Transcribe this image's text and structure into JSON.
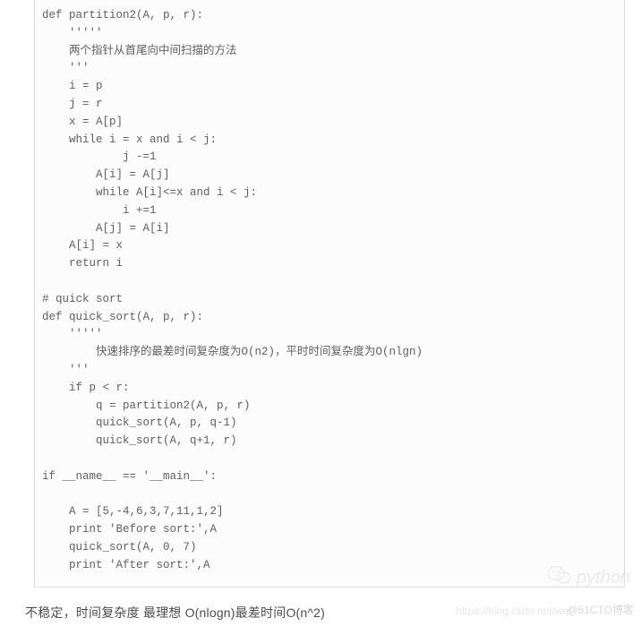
{
  "code": {
    "lines": [
      "def partition2(A, p, r):",
      "    '''''",
      "    两个指针从首尾向中间扫描的方法",
      "    '''",
      "    i = p",
      "    j = r",
      "    x = A[p]",
      "    while i = x and i < j:",
      "            j -=1",
      "        A[i] = A[j]",
      "        while A[i]<=x and i < j:",
      "            i +=1",
      "        A[j] = A[i]",
      "    A[i] = x",
      "    return i",
      "",
      "# quick sort",
      "def quick_sort(A, p, r):",
      "    '''''",
      "        快速排序的最差时间复杂度为O(n2)，平时时间复杂度为O(nlgn)",
      "    '''",
      "    if p < r:",
      "        q = partition2(A, p, r)",
      "        quick_sort(A, p, q-1)",
      "        quick_sort(A, q+1, r)",
      "",
      "if __name__ == '__main__':",
      "",
      "    A = [5,-4,6,3,7,11,1,2]",
      "    print 'Before sort:',A",
      "    quick_sort(A, 0, 7)",
      "    print 'After sort:',A"
    ]
  },
  "caption": "不稳定，时间复杂度 最理想 O(nlogn)最差时间O(n^2)",
  "watermarks": {
    "python_text": "python",
    "csdn": "https://blog.csdn.net/wei",
    "cto": "@51CTO博客"
  }
}
